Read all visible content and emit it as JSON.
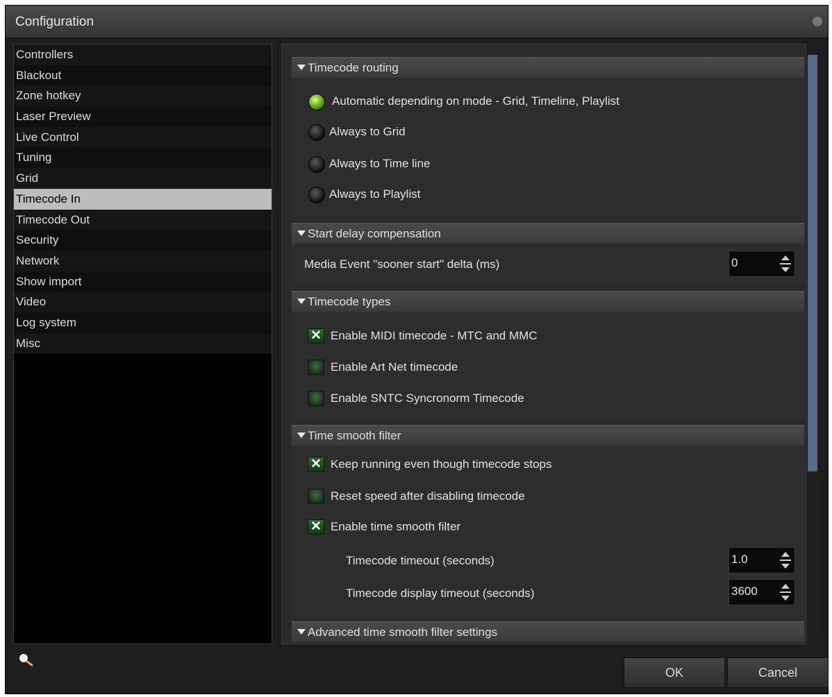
{
  "window": {
    "title": "Configuration"
  },
  "sidebar": {
    "items": [
      {
        "label": "Controllers"
      },
      {
        "label": "Blackout"
      },
      {
        "label": "Zone hotkey"
      },
      {
        "label": "Laser Preview"
      },
      {
        "label": "Live Control"
      },
      {
        "label": "Tuning"
      },
      {
        "label": "Grid"
      },
      {
        "label": "Timecode In"
      },
      {
        "label": "Timecode Out"
      },
      {
        "label": "Security"
      },
      {
        "label": "Network"
      },
      {
        "label": "Show import"
      },
      {
        "label": "Video"
      },
      {
        "label": "Log system"
      },
      {
        "label": "Misc"
      }
    ],
    "selected": "Timecode In"
  },
  "sections": {
    "routing": {
      "title": "Timecode routing",
      "options": [
        {
          "label": "Automatic depending on mode - Grid, Timeline, Playlist",
          "selected": true
        },
        {
          "label": "Always to Grid",
          "selected": false
        },
        {
          "label": "Always to Time line",
          "selected": false
        },
        {
          "label": "Always to Playlist",
          "selected": false
        }
      ]
    },
    "delay": {
      "title": "Start delay compensation",
      "field_label": "Media Event \"sooner start\" delta (ms)",
      "field_value": "0"
    },
    "types": {
      "title": "Timecode types",
      "options": [
        {
          "label": "Enable MIDI timecode - MTC and MMC",
          "checked": true
        },
        {
          "label": "Enable Art Net timecode",
          "checked": false
        },
        {
          "label": "Enable SNTC Syncronorm Timecode",
          "checked": false
        }
      ]
    },
    "smooth": {
      "title": "Time smooth filter",
      "options": [
        {
          "label": "Keep running even though timecode stops",
          "checked": true
        },
        {
          "label": "Reset speed after disabling timecode",
          "checked": false
        },
        {
          "label": "Enable time smooth filter",
          "checked": true
        }
      ],
      "timeout_label": "Timecode timeout (seconds)",
      "timeout_value": "1.0",
      "display_timeout_label": "Timecode display timeout (seconds)",
      "display_timeout_value": "3600"
    },
    "advanced": {
      "title": "Advanced time smooth filter settings"
    }
  },
  "buttons": {
    "ok": "OK",
    "cancel": "Cancel"
  },
  "colors": {
    "radio_on": "#7ad21a",
    "selection": "#bdbdbd",
    "scroll_thumb": "#5b6a8a"
  }
}
